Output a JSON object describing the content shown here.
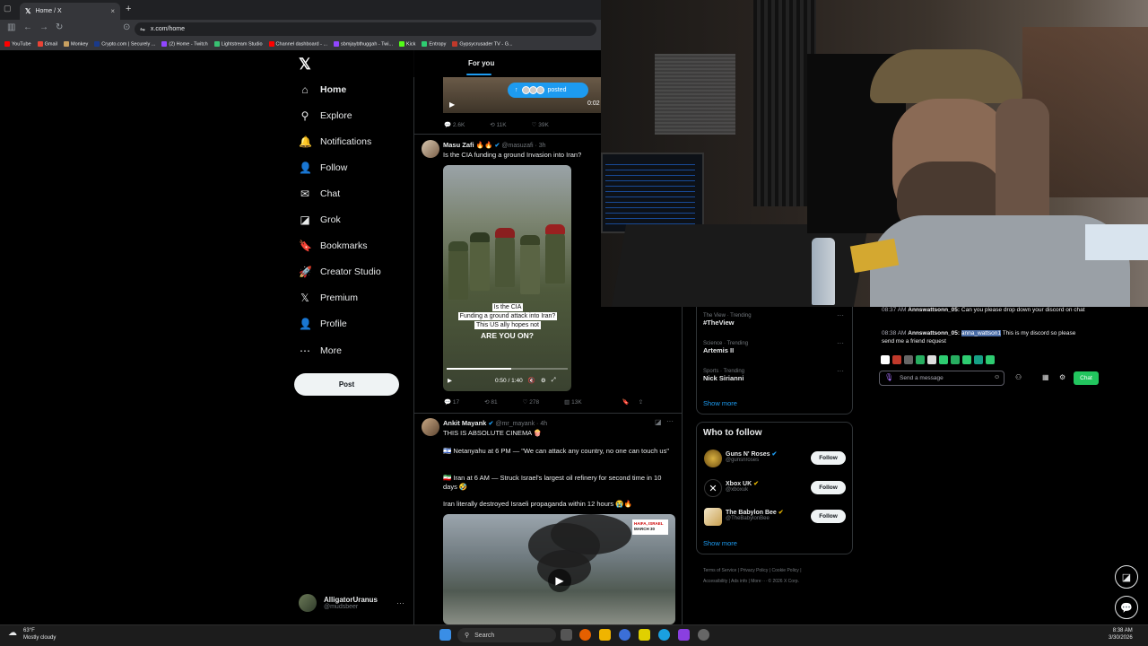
{
  "browser": {
    "tab_title": "Home / X",
    "tab_close": "×",
    "new_tab": "+",
    "url": "x.com/home",
    "bookmarks": [
      "YouTube",
      "Gmail",
      "Monkey",
      "Crypto.com | Securely ...",
      "(2) Home - Twitch",
      "Lightstream Studio",
      "Channel dashboard - ...",
      "sbmjaybthuggah - Twi...",
      "Kick",
      "Entropy",
      "Gypsycrusader TV - G..."
    ]
  },
  "sidebar": {
    "logo": "𝕏",
    "items": [
      {
        "label": "Home",
        "icon": "home-icon",
        "glyph": "⌂"
      },
      {
        "label": "Explore",
        "icon": "search-icon",
        "glyph": "⚲"
      },
      {
        "label": "Notifications",
        "icon": "bell-icon",
        "glyph": "🔔"
      },
      {
        "label": "Follow",
        "icon": "person-add-icon",
        "glyph": "👤"
      },
      {
        "label": "Chat",
        "icon": "mail-icon",
        "glyph": "✉"
      },
      {
        "label": "Grok",
        "icon": "grok-icon",
        "glyph": "◪"
      },
      {
        "label": "Bookmarks",
        "icon": "bookmark-icon",
        "glyph": "🔖"
      },
      {
        "label": "Creator Studio",
        "icon": "rocket-icon",
        "glyph": "🚀"
      },
      {
        "label": "Premium",
        "icon": "x-premium-icon",
        "glyph": "𝕏"
      },
      {
        "label": "Profile",
        "icon": "profile-icon",
        "glyph": "👤"
      },
      {
        "label": "More",
        "icon": "more-circle-icon",
        "glyph": "⋯"
      }
    ],
    "post_button": "Post",
    "account": {
      "name": "AlligatorUranus",
      "handle": "@mudsbeer",
      "more": "···"
    }
  },
  "feed": {
    "tab": "For you",
    "posted_pill": "posted",
    "top_video_time": "0:02",
    "top_post_actions": [
      "2.6K",
      "11K",
      "39K"
    ],
    "posts": [
      {
        "name": "Masu Zafi 🔥🔥",
        "handle": "@masuzafi · 3h",
        "text": "Is the CIA funding a ground Invasion into Iran?",
        "video_caption_1": "Is the CIA",
        "video_caption_2": "Funding a ground attack into Iran?",
        "video_caption_3": "This US ally hopes not",
        "video_caption_bold": "ARE YOU ON?",
        "video_time": "0:50 / 1:40",
        "actions": [
          "17",
          "81",
          "278",
          "13K"
        ]
      },
      {
        "name": "Ankit Mayank",
        "handle": "@mr_mayank · 4h",
        "text_1": "THIS IS ABSOLUTE CINEMA 🍿",
        "text_2": "🇮🇱 Netanyahu at 6 PM — \"We can attack any country, no one can touch us\"",
        "text_3": "🇮🇷 Iran at 6 AM — Struck Israel's largest oil refinery for second time in 10 days 🤣",
        "text_4": "Iran literally destroyed Israeli propaganda within 12 hours 😭🔥",
        "video_badge_1": "HAIFA, ISRAEL",
        "video_badge_2": "MARCH 30"
      }
    ]
  },
  "trends": [
    {
      "label": "The View · Trending",
      "name": "#TheView"
    },
    {
      "label": "Science · Trending",
      "name": "Artemis II"
    },
    {
      "label": "Sports · Trending",
      "name": "Nick Sirianni"
    }
  ],
  "trends_more": "Show more",
  "who_to_follow": {
    "title": "Who to follow",
    "users": [
      {
        "name": "Guns N' Roses",
        "handle": "@gunsnroses"
      },
      {
        "name": "Xbox UK",
        "handle": "@xboxuk"
      },
      {
        "name": "The Babylon Bee",
        "handle": "@TheBabylonBee"
      }
    ],
    "follow_label": "Follow",
    "show_more": "Show more"
  },
  "footer": {
    "links": [
      "Terms of Service",
      "Privacy Policy",
      "Cookie Policy",
      "Accessibility",
      "Ads info",
      "More ···",
      "© 2026 X Corp."
    ]
  },
  "stream_chat": {
    "messages": [
      {
        "time": "08:37 AM",
        "user": "Annswattsonn_05:",
        "text": "Can you please drop down your discord on chat"
      },
      {
        "time": "08:38 AM",
        "user": "Annswattsonn_05:",
        "highlight": "anna_wattson1",
        "text": "This is my discord so please send me a friend request"
      }
    ],
    "input_placeholder": "Send a message",
    "send_button": "Chat"
  },
  "taskbar": {
    "temperature": "63°F",
    "weather": "Mostly cloudy",
    "search": "Search",
    "time": "8:38 AM",
    "date": "3/30/2026"
  }
}
